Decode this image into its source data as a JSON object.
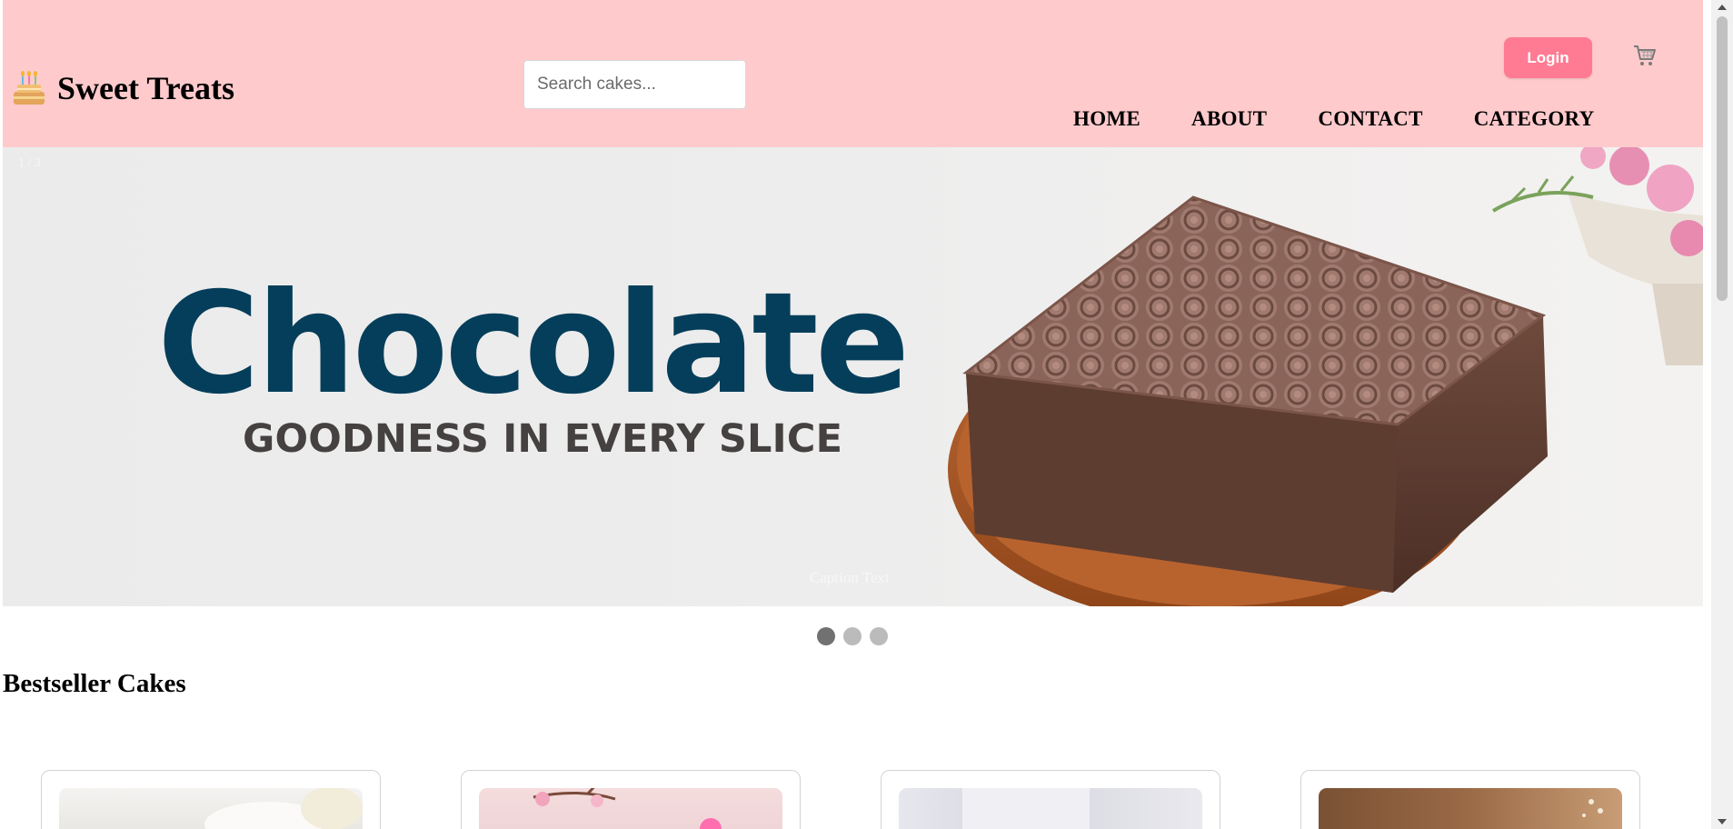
{
  "header": {
    "logo_emoji": "🎂",
    "logo_text": "Sweet Treats",
    "search_placeholder": "Search cakes...",
    "login_label": "Login",
    "cart_icon": "cart-icon",
    "nav": [
      "HOME",
      "ABOUT",
      "CONTACT",
      "CATEGORY"
    ],
    "background_color": "#ffcacc",
    "login_color": "#ff7b94"
  },
  "hero": {
    "slide_number": "1 / 3",
    "title": "Chocolate",
    "subtitle": "GOODNESS IN EVERY SLICE",
    "caption": "Caption Text",
    "slide_count": 3,
    "active_slide": 1,
    "title_color": "#053e5a"
  },
  "bestsellers": {
    "title": "Bestseller Cakes",
    "card_count": 4
  }
}
